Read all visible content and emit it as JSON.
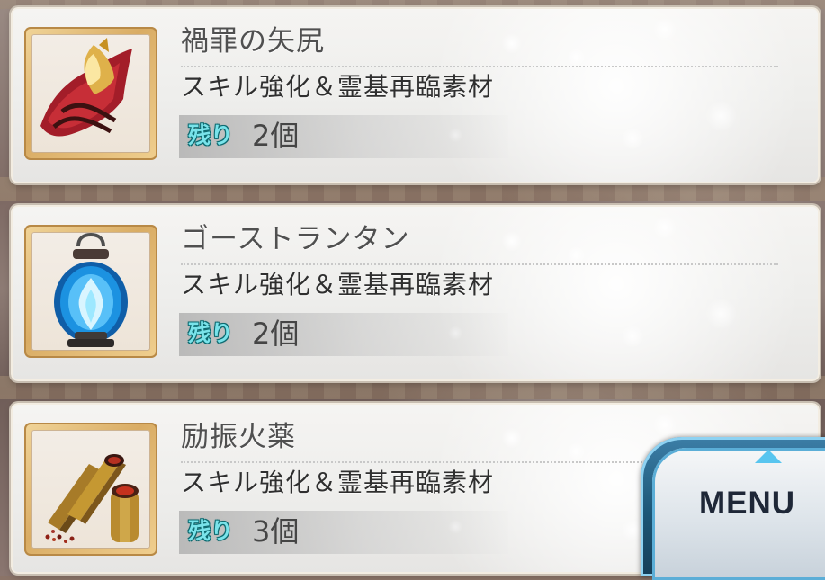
{
  "items": [
    {
      "name": "禍罪の矢尻",
      "description": "スキル強化＆霊基再臨素材",
      "quantity_label": "残り",
      "quantity_value": "2個",
      "icon": "arrowhead-icon"
    },
    {
      "name": "ゴーストランタン",
      "description": "スキル強化＆霊基再臨素材",
      "quantity_label": "残り",
      "quantity_value": "2個",
      "icon": "ghost-lantern-icon"
    },
    {
      "name": "励振火薬",
      "description": "スキル強化＆霊基再臨素材",
      "quantity_label": "残り",
      "quantity_value": "3個",
      "icon": "gunpowder-icon"
    }
  ],
  "menu": {
    "label": "MENU"
  },
  "colors": {
    "quantity_label": "#79e3ea",
    "menu_accent": "#3c7ea7",
    "thumbnail_frame": "#d9ac64"
  }
}
